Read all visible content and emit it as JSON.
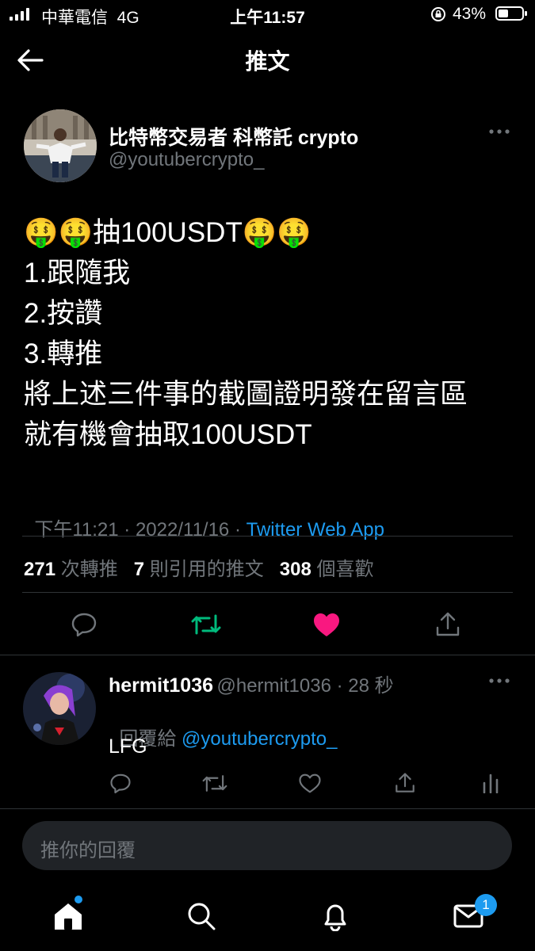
{
  "status_bar": {
    "carrier": "中華電信  4G",
    "time": "上午11:57",
    "battery_pct": "43%"
  },
  "header": {
    "title": "推文"
  },
  "tweet": {
    "author_name": "比特幣交易者 科幣託 crypto",
    "author_handle": "@youtubercrypto_",
    "body_lines": [
      "🤑🤑抽100USDT🤑🤑",
      "1.跟隨我",
      "2.按讚",
      "3.轉推",
      "將上述三件事的截圖證明發在留言區",
      "就有機會抽取100USDT"
    ],
    "timestamp": "下午11:21 · 2022/11/16 · ",
    "source": "Twitter Web App",
    "retweets_count": "271",
    "retweets_label": "次轉推",
    "quotes_count": "7",
    "quotes_label": "則引用的推文",
    "likes_count": "308",
    "likes_label": "個喜歡",
    "liked": true
  },
  "reply": {
    "author_name": "hermit1036",
    "author_handle_time": "@hermit1036 · 28 秒",
    "replying_prefix": "回覆給 ",
    "replying_to": "@youtubercrypto_",
    "text": "LFG"
  },
  "composer": {
    "placeholder": "推你的回覆"
  },
  "bottom_nav": {
    "messages_badge": "1"
  },
  "colors": {
    "accent": "#1d9bf0",
    "retweet": "#00ba7c",
    "like": "#f91880",
    "muted": "#71767b"
  }
}
